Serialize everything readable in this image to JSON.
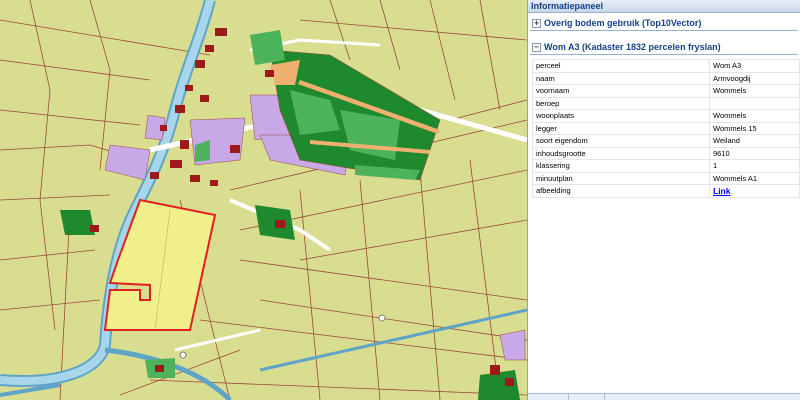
{
  "panel": {
    "title": "Informatiepaneel",
    "sections": [
      {
        "label": "Overig bodem gebruik (Top10Vector)",
        "expanded": false,
        "icon": "plus-icon"
      },
      {
        "label": "Wom A3 (Kadaster 1832 percelen fryslan)",
        "expanded": true,
        "icon": "minus-icon"
      }
    ],
    "attributes": [
      {
        "key": "perceel",
        "value": "Wom A3"
      },
      {
        "key": "naam",
        "value": "Armvoogdij"
      },
      {
        "key": "voornaam",
        "value": "Wommels"
      },
      {
        "key": "beroep",
        "value": ""
      },
      {
        "key": "woonplaats",
        "value": "Wommels"
      },
      {
        "key": "legger",
        "value": "Wommels 15"
      },
      {
        "key": "soort eigendom",
        "value": "Weiland"
      },
      {
        "key": "inhoudsgrootte",
        "value": "9610"
      },
      {
        "key": "klassering",
        "value": "1"
      },
      {
        "key": "minuutplan",
        "value": "Wommels A1"
      },
      {
        "key": "afbeelding",
        "value": "Link"
      }
    ]
  },
  "map": {
    "colors": {
      "land": "#d9dd8f",
      "water": "#8ec5de",
      "parcel_line": "#9b4a3c",
      "built": "#c8a8e6",
      "forest": "#1f8a2d",
      "green": "#4db35b",
      "building": "#9e1a1a",
      "selected_fill": "#f1ef8c",
      "selected_outline": "#e02020",
      "road": "#f2f2f2"
    }
  }
}
